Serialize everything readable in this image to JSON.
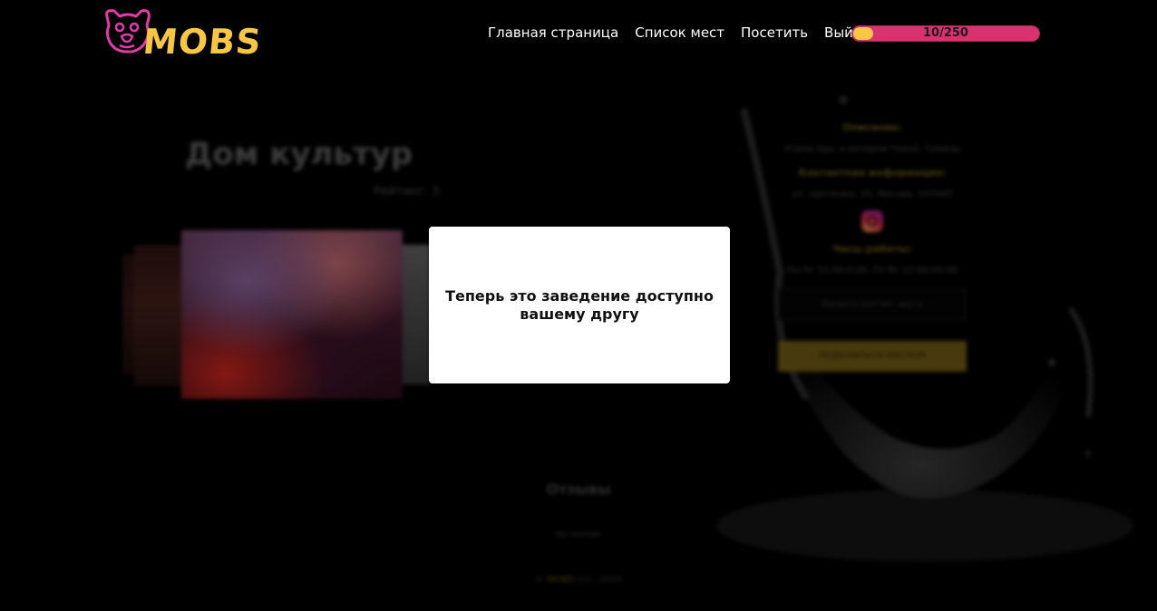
{
  "header": {
    "logo_text": "MOBS",
    "nav": [
      {
        "label": "Главная страница"
      },
      {
        "label": "Список мест"
      },
      {
        "label": "Посетить"
      },
      {
        "label": "Выйти"
      }
    ],
    "progress": {
      "label": "10/250",
      "fraction": 0.04
    }
  },
  "venue": {
    "title": "Дом культур",
    "rating": "Рейтинг: 3",
    "description_label": "Описание:",
    "description": "Утром еда, а вечером техно, туманы",
    "contacts_label": "Контактная информация:",
    "address": "ул. Сретенка, 25, Москва, 107045",
    "hours_label": "Часы работы:",
    "hours": "Пн-Чт 12:00-0:00, Пт-Вс 12:00-05:00",
    "friend_placeholder": "Введите контакт друга",
    "share_label": "ПОДЕЛИТЬСЯ МЕСТОМ"
  },
  "reviews": {
    "title": "Отзывы",
    "empty": "No reviews"
  },
  "footer": {
    "prefix": "©",
    "brand": "MOBS",
    "suffix": "LLC, 2020"
  },
  "modal": {
    "message": "Теперь это заведение доступно вашему другу"
  },
  "colors": {
    "accent_yellow": "#f7c744",
    "accent_pink": "#d9336f",
    "background": "#000000"
  }
}
